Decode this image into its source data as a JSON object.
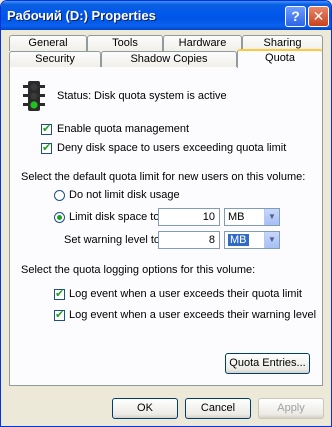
{
  "window": {
    "title": "Рабочий (D:) Properties",
    "help_label": "?",
    "close_label": "✕"
  },
  "tabs": {
    "row_back": [
      "General",
      "Tools",
      "Hardware",
      "Sharing"
    ],
    "row_front": [
      "Security",
      "Shadow Copies",
      "Quota"
    ],
    "active": "Quota"
  },
  "quota": {
    "status_label": "Status:",
    "status_text": "Disk quota system is active",
    "enable_label": "Enable quota management",
    "enable_checked": true,
    "deny_label": "Deny disk space to users exceeding quota limit",
    "deny_checked": true,
    "default_heading": "Select the default quota limit for new users on this volume:",
    "no_limit_label": "Do not limit disk usage",
    "limit_label": "Limit disk space to",
    "limit_value": "10",
    "limit_unit": "MB",
    "warning_label": "Set warning level to",
    "warning_value": "8",
    "warning_unit": "MB",
    "logging_heading": "Select the quota logging options for this volume:",
    "log_limit_label": "Log event when a user exceeds their quota limit",
    "log_limit_checked": true,
    "log_warning_label": "Log event when a user exceeds their warning level",
    "log_warning_checked": true,
    "entries_button": "Quota Entries..."
  },
  "footer": {
    "ok": "OK",
    "cancel": "Cancel",
    "apply": "Apply"
  },
  "icons": {
    "traffic_light": "traffic-light-icon",
    "checkmark": "✔",
    "dropdown": "▼"
  },
  "colors": {
    "title_bar": "#0054e3",
    "dialog_bg": "#ece9d8",
    "active_tab_highlight": "#ffc83c",
    "check_green": "#21a121",
    "selection_blue": "#316ac5"
  }
}
